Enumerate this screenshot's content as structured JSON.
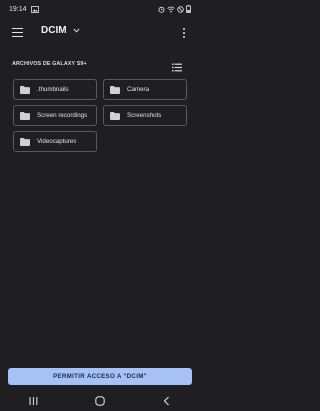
{
  "status_bar": {
    "time": "19:14"
  },
  "app_bar": {
    "title": "DCIM"
  },
  "section": {
    "title": "ARCHIVOS DE GALAXY S9+"
  },
  "folders": [
    {
      "label": ".thumbnails"
    },
    {
      "label": "Camera"
    },
    {
      "label": "Screen recordings"
    },
    {
      "label": "Screenshots"
    },
    {
      "label": "Videocaptures"
    }
  ],
  "allow_button": {
    "label": "PERMITIR ACCESO A \"DCIM\""
  },
  "colors": {
    "background": "#1f1f21",
    "accent": "#a6c1f5",
    "folder_border": "#585a5e"
  },
  "icons": [
    "menu-icon",
    "dropdown-arrow-icon",
    "overflow-menu-icon",
    "list-view-icon",
    "folder-icon",
    "recents-icon",
    "home-icon",
    "back-icon"
  ]
}
